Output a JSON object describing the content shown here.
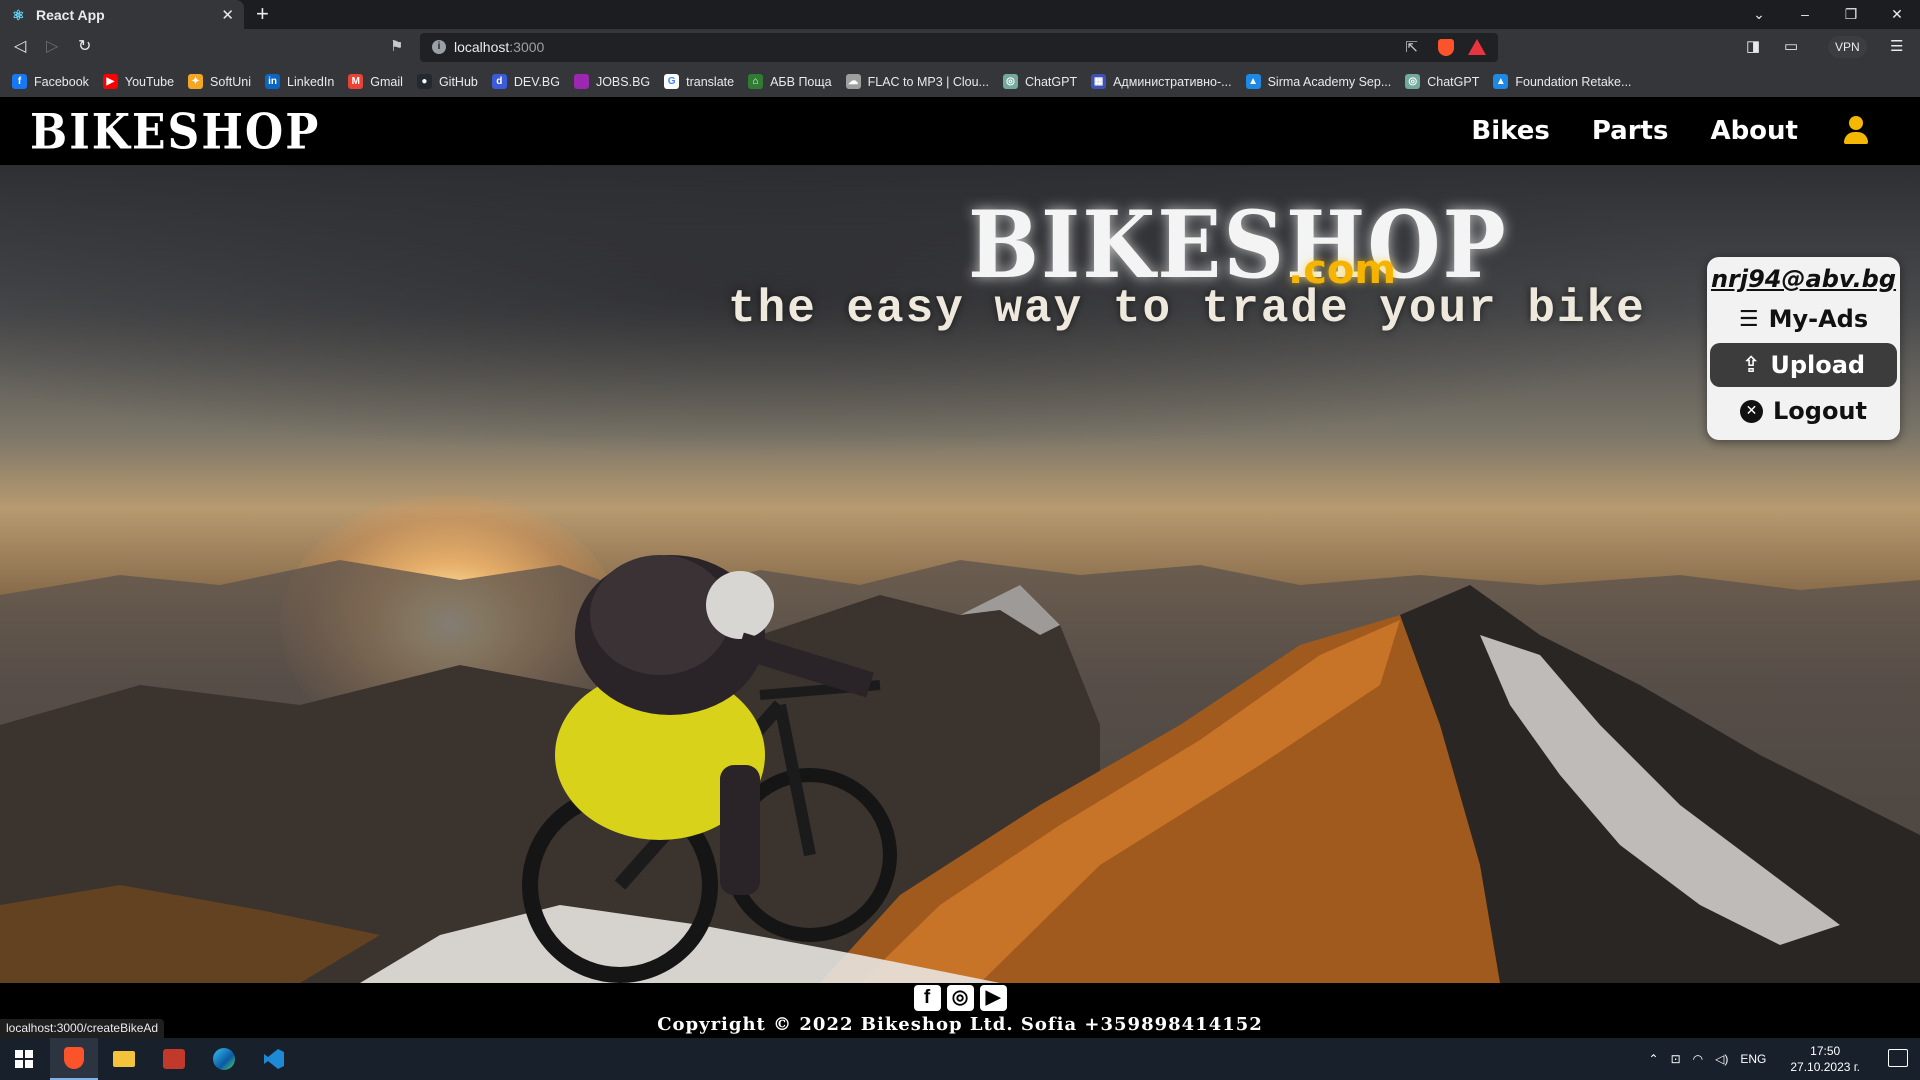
{
  "browser": {
    "tab_title": "React App",
    "tab_close": "✕",
    "new_tab": "+",
    "url_host": "localhost",
    "url_port": ":3000",
    "vpn_label": "VPN",
    "status_url": "localhost:3000/createBikeAd",
    "bookmarks": [
      {
        "label": "Facebook",
        "icon": "facebook-icon",
        "color": "#1877f2",
        "glyph": "f"
      },
      {
        "label": "YouTube",
        "icon": "youtube-icon",
        "color": "#ff0000",
        "glyph": "▶"
      },
      {
        "label": "SoftUni",
        "icon": "softuni-icon",
        "color": "#f5a623",
        "glyph": "✦"
      },
      {
        "label": "LinkedIn",
        "icon": "linkedin-icon",
        "color": "#0a66c2",
        "glyph": "in"
      },
      {
        "label": "Gmail",
        "icon": "gmail-icon",
        "color": "#ea4335",
        "glyph": "M"
      },
      {
        "label": "GitHub",
        "icon": "github-icon",
        "color": "#24292f",
        "glyph": "●"
      },
      {
        "label": "DEV.BG",
        "icon": "devbg-icon",
        "color": "#3b5bdb",
        "glyph": "d"
      },
      {
        "label": "JOBS.BG",
        "icon": "jobsbg-icon",
        "color": "#9c27b0",
        "glyph": ""
      },
      {
        "label": "translate",
        "icon": "google-icon",
        "color": "#ffffff",
        "glyph": "G"
      },
      {
        "label": "АБВ Поща",
        "icon": "abv-icon",
        "color": "#2e7d32",
        "glyph": "⌂"
      },
      {
        "label": "FLAC to MP3 | Clou...",
        "icon": "cloud-icon",
        "color": "#9e9e9e",
        "glyph": "☁"
      },
      {
        "label": "ChatGPT",
        "icon": "chatgpt-icon",
        "color": "#74aa9c",
        "glyph": "◎"
      },
      {
        "label": "Административно-...",
        "icon": "admin-icon",
        "color": "#3f51b5",
        "glyph": "▦"
      },
      {
        "label": "Sirma Academy Sep...",
        "icon": "sirma-icon",
        "color": "#1e88e5",
        "glyph": "▲"
      },
      {
        "label": "ChatGPT",
        "icon": "chatgpt-icon",
        "color": "#74aa9c",
        "glyph": "◎"
      },
      {
        "label": "Foundation Retake...",
        "icon": "foundation-icon",
        "color": "#1e88e5",
        "glyph": "▲"
      }
    ]
  },
  "site": {
    "logo": "BIKESHOP",
    "nav": [
      "Bikes",
      "Parts",
      "About"
    ],
    "hero_title": "BIKESHOP",
    "hero_title_suffix": ".com",
    "hero_slogan": "the easy way to trade your bike",
    "user_menu": {
      "email": "nrj94@abv.bg",
      "items": [
        {
          "label": "My-Ads",
          "icon": "list-icon"
        },
        {
          "label": "Upload",
          "icon": "upload-icon"
        },
        {
          "label": "Logout",
          "icon": "x-circle-icon"
        }
      ]
    },
    "footer": {
      "social": [
        "facebook-icon",
        "instagram-icon",
        "youtube-icon"
      ],
      "copyright": "Copyright © 2022 Bikeshop Ltd. Sofia +359898414152"
    },
    "colors": {
      "accent": "#f5b800",
      "navbar_bg": "#000000",
      "menu_bg": "#f2f2f2",
      "menu_active_bg": "#3c3c3c"
    }
  },
  "taskbar": {
    "apps": [
      "windows-start-icon",
      "brave-icon",
      "file-explorer-icon",
      "app-icon",
      "edge-icon",
      "vscode-icon"
    ],
    "language": "ENG",
    "time": "17:50",
    "date": "27.10.2023 г."
  }
}
